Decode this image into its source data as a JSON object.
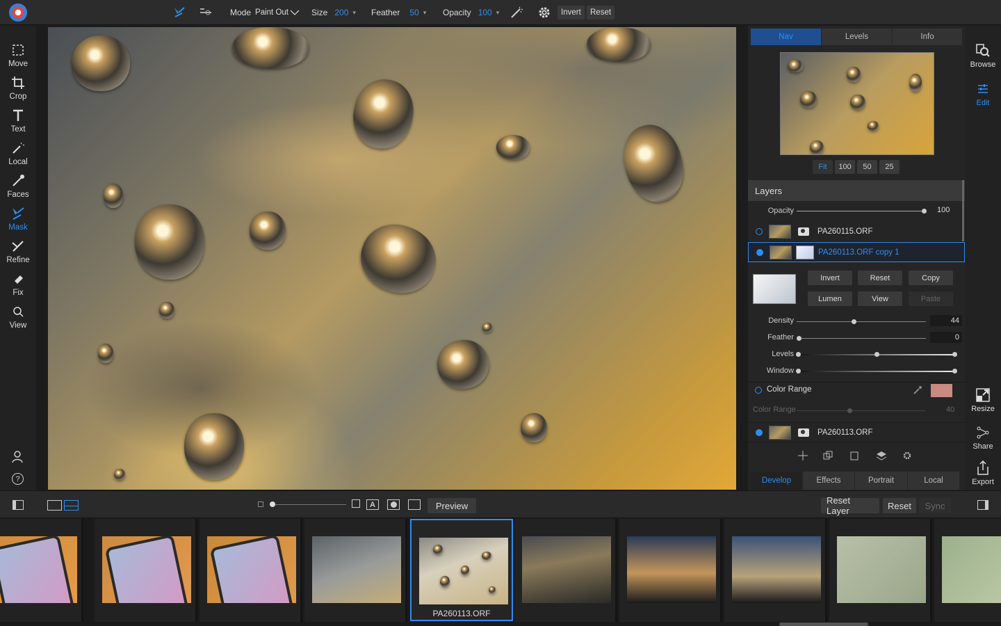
{
  "topbar": {
    "mode_label": "Mode",
    "mode_value": "Paint Out",
    "size_label": "Size",
    "size_value": "200",
    "feather_label": "Feather",
    "feather_value": "50",
    "opacity_label": "Opacity",
    "opacity_value": "100",
    "invert_label": "Invert",
    "reset_label": "Reset"
  },
  "left_tools": [
    {
      "label": "Move",
      "icon": "move-icon"
    },
    {
      "label": "Crop",
      "icon": "crop-icon"
    },
    {
      "label": "Text",
      "icon": "text-icon"
    },
    {
      "label": "Local",
      "icon": "local-brush-icon"
    },
    {
      "label": "Faces",
      "icon": "faces-icon"
    },
    {
      "label": "Mask",
      "icon": "mask-brush-icon",
      "active": true
    },
    {
      "label": "Refine",
      "icon": "refine-brush-icon"
    },
    {
      "label": "Fix",
      "icon": "fix-icon"
    },
    {
      "label": "View",
      "icon": "magnifier-icon"
    }
  ],
  "right_panel": {
    "tabs": [
      "Nav",
      "Levels",
      "Info"
    ],
    "zoom": [
      "Fit",
      "100",
      "50",
      "25"
    ],
    "layers_title": "Layers",
    "opacity_label": "Opacity",
    "opacity_value": "100",
    "layers": [
      {
        "name": "PA260115.ORF",
        "selected": false,
        "active": false
      },
      {
        "name": "PA260113.ORF copy 1",
        "selected": true,
        "active": true
      },
      {
        "name": "PA260113.ORF",
        "selected": false,
        "active": true
      }
    ],
    "mask_buttons": [
      "Invert",
      "Reset",
      "Copy",
      "Lumen",
      "View",
      "Paste"
    ],
    "density_label": "Density",
    "density_value": "44",
    "feather_label": "Feather",
    "feather_value": "0",
    "levels_label": "Levels",
    "window_label": "Window",
    "color_range_label": "Color Range",
    "color_range_swatch": "#c98a80",
    "color_range_sub_label": "Color Range",
    "color_range_value": "40",
    "bottom_tabs": [
      "Develop",
      "Effects",
      "Portrait",
      "Local"
    ]
  },
  "far_right": [
    {
      "label": "Browse",
      "icon": "browse-icon"
    },
    {
      "label": "Edit",
      "icon": "edit-sliders-icon",
      "active": true
    },
    {
      "label": "Resize",
      "icon": "resize-icon"
    },
    {
      "label": "Share",
      "icon": "share-icon"
    },
    {
      "label": "Export",
      "icon": "export-icon"
    }
  ],
  "bottom_bar": {
    "preview_label": "Preview",
    "reset_layer_label": "Reset Layer",
    "reset_label": "Reset",
    "sync_label": "Sync"
  },
  "filmstrip": {
    "selected_name": "PA260113.ORF",
    "count_visible": 10
  },
  "colors": {
    "accent": "#2e8ef0",
    "panel": "#252525",
    "toolbar": "#2c2c2c"
  }
}
